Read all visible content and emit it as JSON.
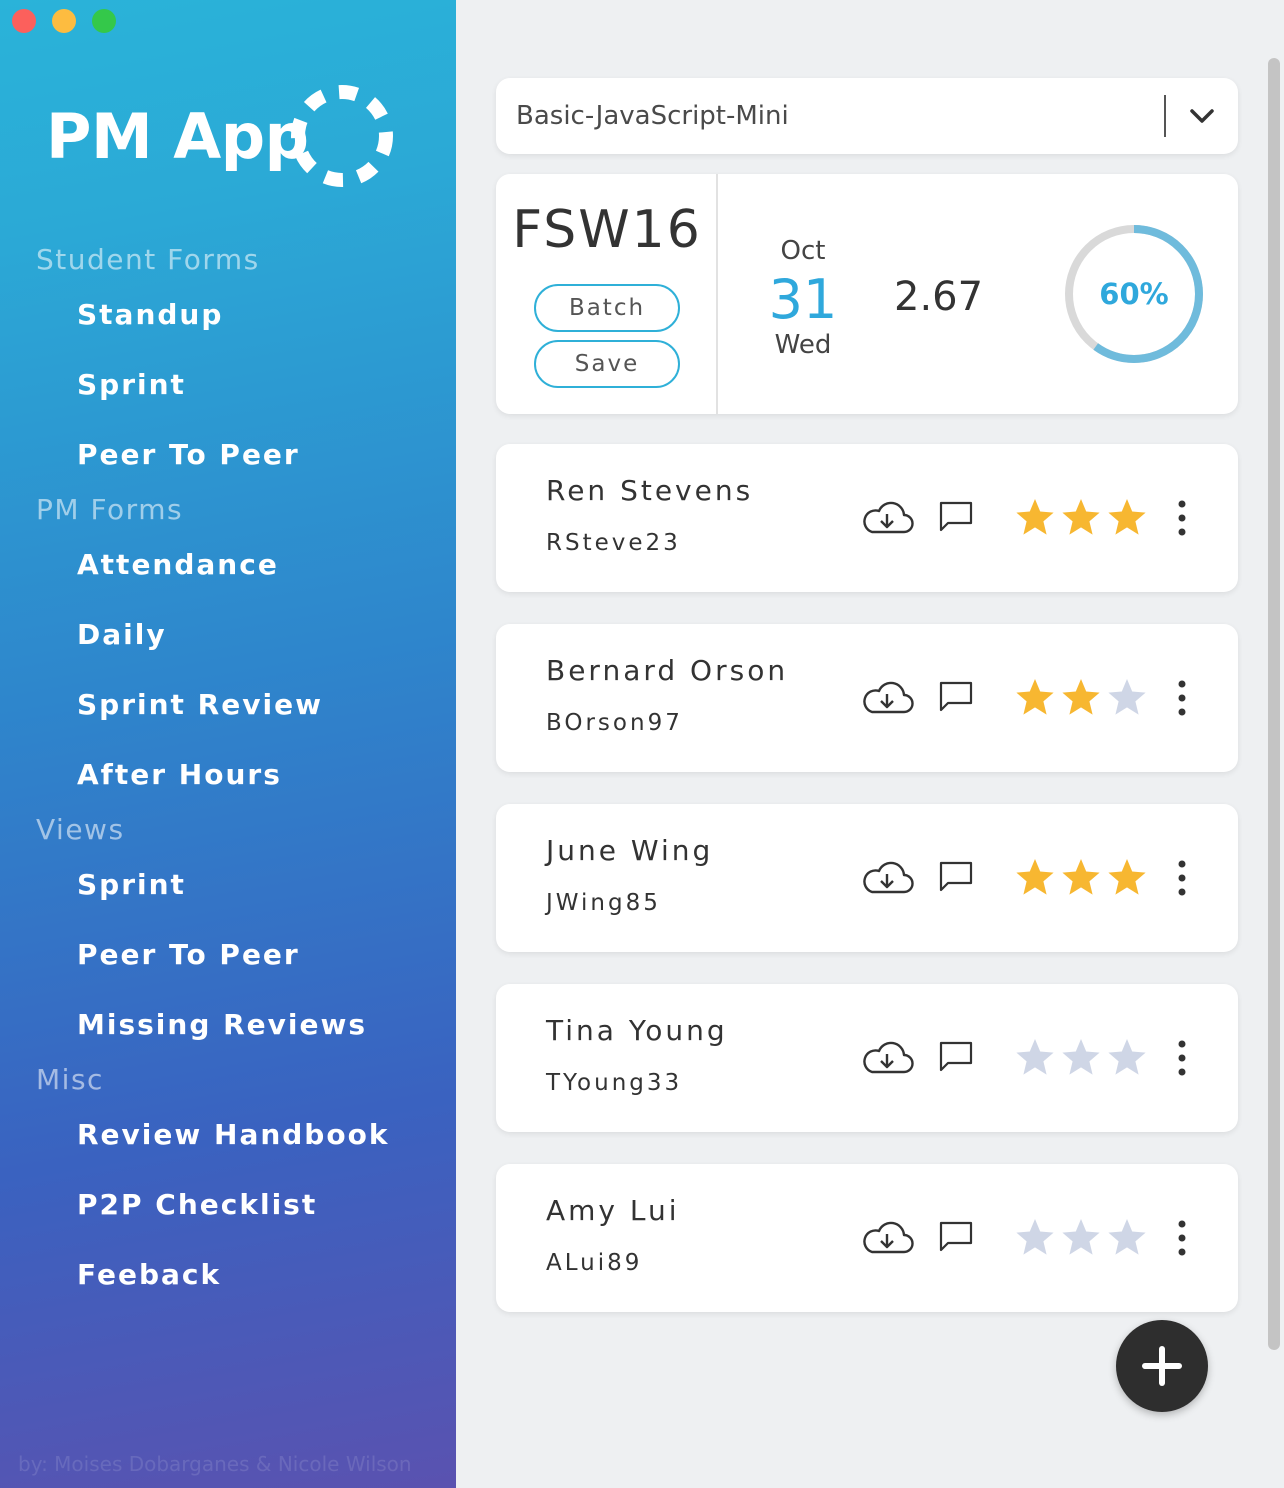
{
  "sidebar": {
    "title": "PM App",
    "sections": [
      {
        "title": "Student Forms",
        "items": [
          "Standup",
          "Sprint",
          "Peer To Peer"
        ]
      },
      {
        "title": "PM Forms",
        "items": [
          "Attendance",
          "Daily",
          "Sprint Review",
          "After Hours"
        ]
      },
      {
        "title": "Views",
        "items": [
          "Sprint",
          "Peer To Peer",
          "Missing Reviews"
        ]
      },
      {
        "title": "Misc",
        "items": [
          "Review Handbook",
          "P2P Checklist",
          "Feeback"
        ]
      }
    ],
    "credit": "by: Moises Dobarganes & Nicole Wilson"
  },
  "project_select": {
    "value": "Basic-JavaScript-Mini"
  },
  "batch": {
    "name": "FSW16",
    "batch_label": "Batch",
    "save_label": "Save",
    "month": "Oct",
    "day": "31",
    "weekday": "Wed",
    "score": "2.67",
    "progress_label": "60%",
    "progress": 0.6
  },
  "students": [
    {
      "name": "Ren Stevens",
      "handle": "RSteve23",
      "rating": 3
    },
    {
      "name": "Bernard Orson",
      "handle": "BOrson97",
      "rating": 2
    },
    {
      "name": "June Wing",
      "handle": "JWing85",
      "rating": 3
    },
    {
      "name": "Tina Young",
      "handle": "TYoung33",
      "rating": 0
    },
    {
      "name": "Amy Lui",
      "handle": "ALui89",
      "rating": 0
    }
  ],
  "colors": {
    "accent": "#2fa8dc",
    "star_on": "#f7b731",
    "star_off": "#cfd6e6",
    "fab": "#2e2e2e"
  },
  "icons": {
    "cloud": "cloud-download-icon",
    "comment": "comment-icon",
    "more": "more-vertical-icon",
    "add": "plus-icon",
    "chevron": "chevron-down-icon"
  }
}
